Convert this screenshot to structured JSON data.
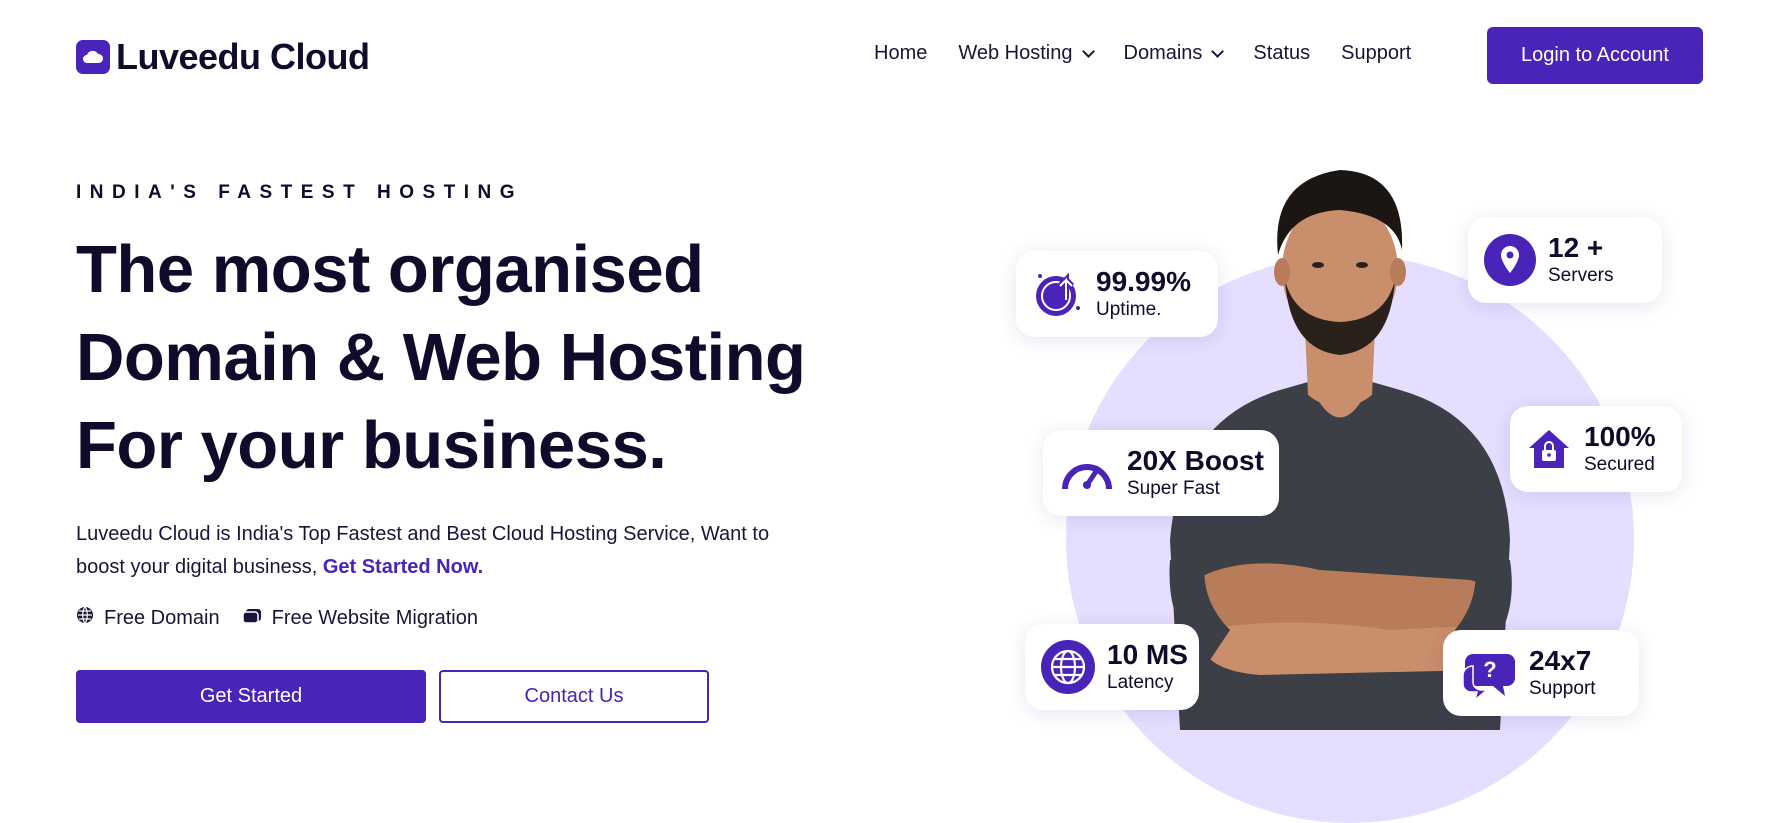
{
  "brand": {
    "name": "Luveedu Cloud",
    "accent": "#4a23b8",
    "circle_bg": "#e5deff"
  },
  "nav": {
    "items": [
      {
        "label": "Home",
        "dropdown": false
      },
      {
        "label": "Web Hosting",
        "dropdown": true
      },
      {
        "label": "Domains",
        "dropdown": true
      },
      {
        "label": "Status",
        "dropdown": false
      },
      {
        "label": "Support",
        "dropdown": false
      }
    ],
    "login_label": "Login to Account"
  },
  "hero": {
    "eyebrow": "INDIA'S FASTEST HOSTING",
    "headline": [
      "The most organised",
      "Domain & Web Hosting",
      "For your business."
    ],
    "description": "Luveedu Cloud is India's Top Fastest and Best Cloud Hosting Service, Want to boost your digital business,",
    "description_link": "Get Started Now.",
    "features": [
      {
        "icon": "globe-icon",
        "label": "Free Domain"
      },
      {
        "icon": "migration-icon",
        "label": "Free Website Migration"
      }
    ],
    "primary_button": "Get Started",
    "secondary_button": "Contact Us"
  },
  "stats": [
    {
      "icon": "uptime-rocket-icon",
      "value": "99.99%",
      "label": "Uptime."
    },
    {
      "icon": "map-pin-icon",
      "value": "12 +",
      "label": "Servers"
    },
    {
      "icon": "speedometer-icon",
      "value": "20X Boost",
      "label": "Super Fast"
    },
    {
      "icon": "secure-home-icon",
      "value": "100%",
      "label": "Secured"
    },
    {
      "icon": "globe-icon",
      "value": "10 MS",
      "label": "Latency"
    },
    {
      "icon": "support-chat-icon",
      "value": "24x7",
      "label": "Support"
    }
  ]
}
